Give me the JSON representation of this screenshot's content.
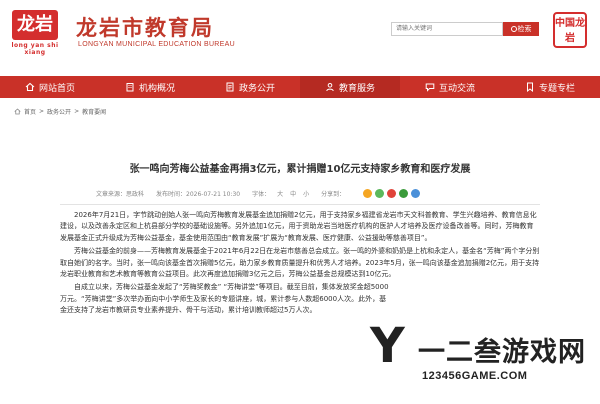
{
  "header": {
    "logo_text": "龙岩",
    "logo_sub": "long yan shi xiang",
    "title": "龙岩市教育局",
    "subtitle": "LONGYAN MUNICIPAL EDUCATION BUREAU",
    "search_placeholder": "请输入关键词",
    "search_label": "检索",
    "stamp_text": "中国龙岩",
    "brand_color": "#c93128"
  },
  "nav": {
    "items": [
      {
        "label": "网站首页",
        "icon": "home-icon"
      },
      {
        "label": "机构概况",
        "icon": "building-icon"
      },
      {
        "label": "政务公开",
        "icon": "document-icon"
      },
      {
        "label": "教育服务",
        "icon": "service-icon"
      },
      {
        "label": "互动交流",
        "icon": "chat-icon"
      },
      {
        "label": "专题专栏",
        "icon": "bookmark-icon"
      }
    ],
    "active_index": 3
  },
  "breadcrumb": {
    "items": [
      "首页",
      "政务公开",
      "教育要闻"
    ],
    "separator": ">"
  },
  "article": {
    "title": "张一鸣向芳梅公益基金再捐3亿元，累计捐赠10亿元支持家乡教育和医疗发展",
    "source": "文章来源：思政科",
    "date": "发布时间：2026-07-21 10:30",
    "font_label": "字体：",
    "font_sizes": [
      "大",
      "中",
      "小"
    ],
    "share_label": "分享到：",
    "share_icons": [
      "qzone-icon",
      "wechat-icon",
      "weibo-icon",
      "douban-icon",
      "more-icon"
    ],
    "paragraphs": [
      "2026年7月21日，字节跳动创始人张一鸣向芳梅教育发展基金追加捐赠2亿元，用于支持家乡福建省龙岩市天文科普教育、学生兴趣培养、教育信息化建设，以及改善永定区和上杭县部分学校的基础设施等。另外追加1亿元，用于资助龙岩当地医疗机构的医护人才培养及医疗设备改善等。同时，芳梅教育发展基金正式升级成为芳梅公益基金，基金使用范围由“教育发展”扩展为“教育发展、医疗健康、公益援助等慈善项目”。",
      "芳梅公益基金的前身——芳梅教育发展基金于2021年6月22日在龙岩市慈善总会成立。张一鸣的外婆和奶奶是上杭和永定人，基金名“芳梅”两个字分别取自她们的名字。当时，张一鸣向该基金首次捐赠5亿元，助力家乡教育质量提升和优秀人才培养。2023年5月，张一鸣向该基金追加捐赠2亿元，用于支持龙岩职业教育和艺术教育等教育公益项目。此次再度追加捐赠3亿元之后，芳梅公益基金总规模达到10亿元。",
      "自成立以来，芳梅公益基金发起了“芳梅奖教金” “芳梅讲堂”等项目。截至目前，集体发放奖金超5000万元。“芳梅讲堂”多次举办面向中小学师生及家长的专题讲座，城，累计参与人数超6000人次。此外，基金还支持了龙岩市教研员专业素养提升、骨干与活动，累计培训教师超过5万人次。"
    ]
  },
  "watermark": {
    "mark": "Y",
    "text": "一二叁游戏网",
    "url": "123456GAME.COM"
  }
}
